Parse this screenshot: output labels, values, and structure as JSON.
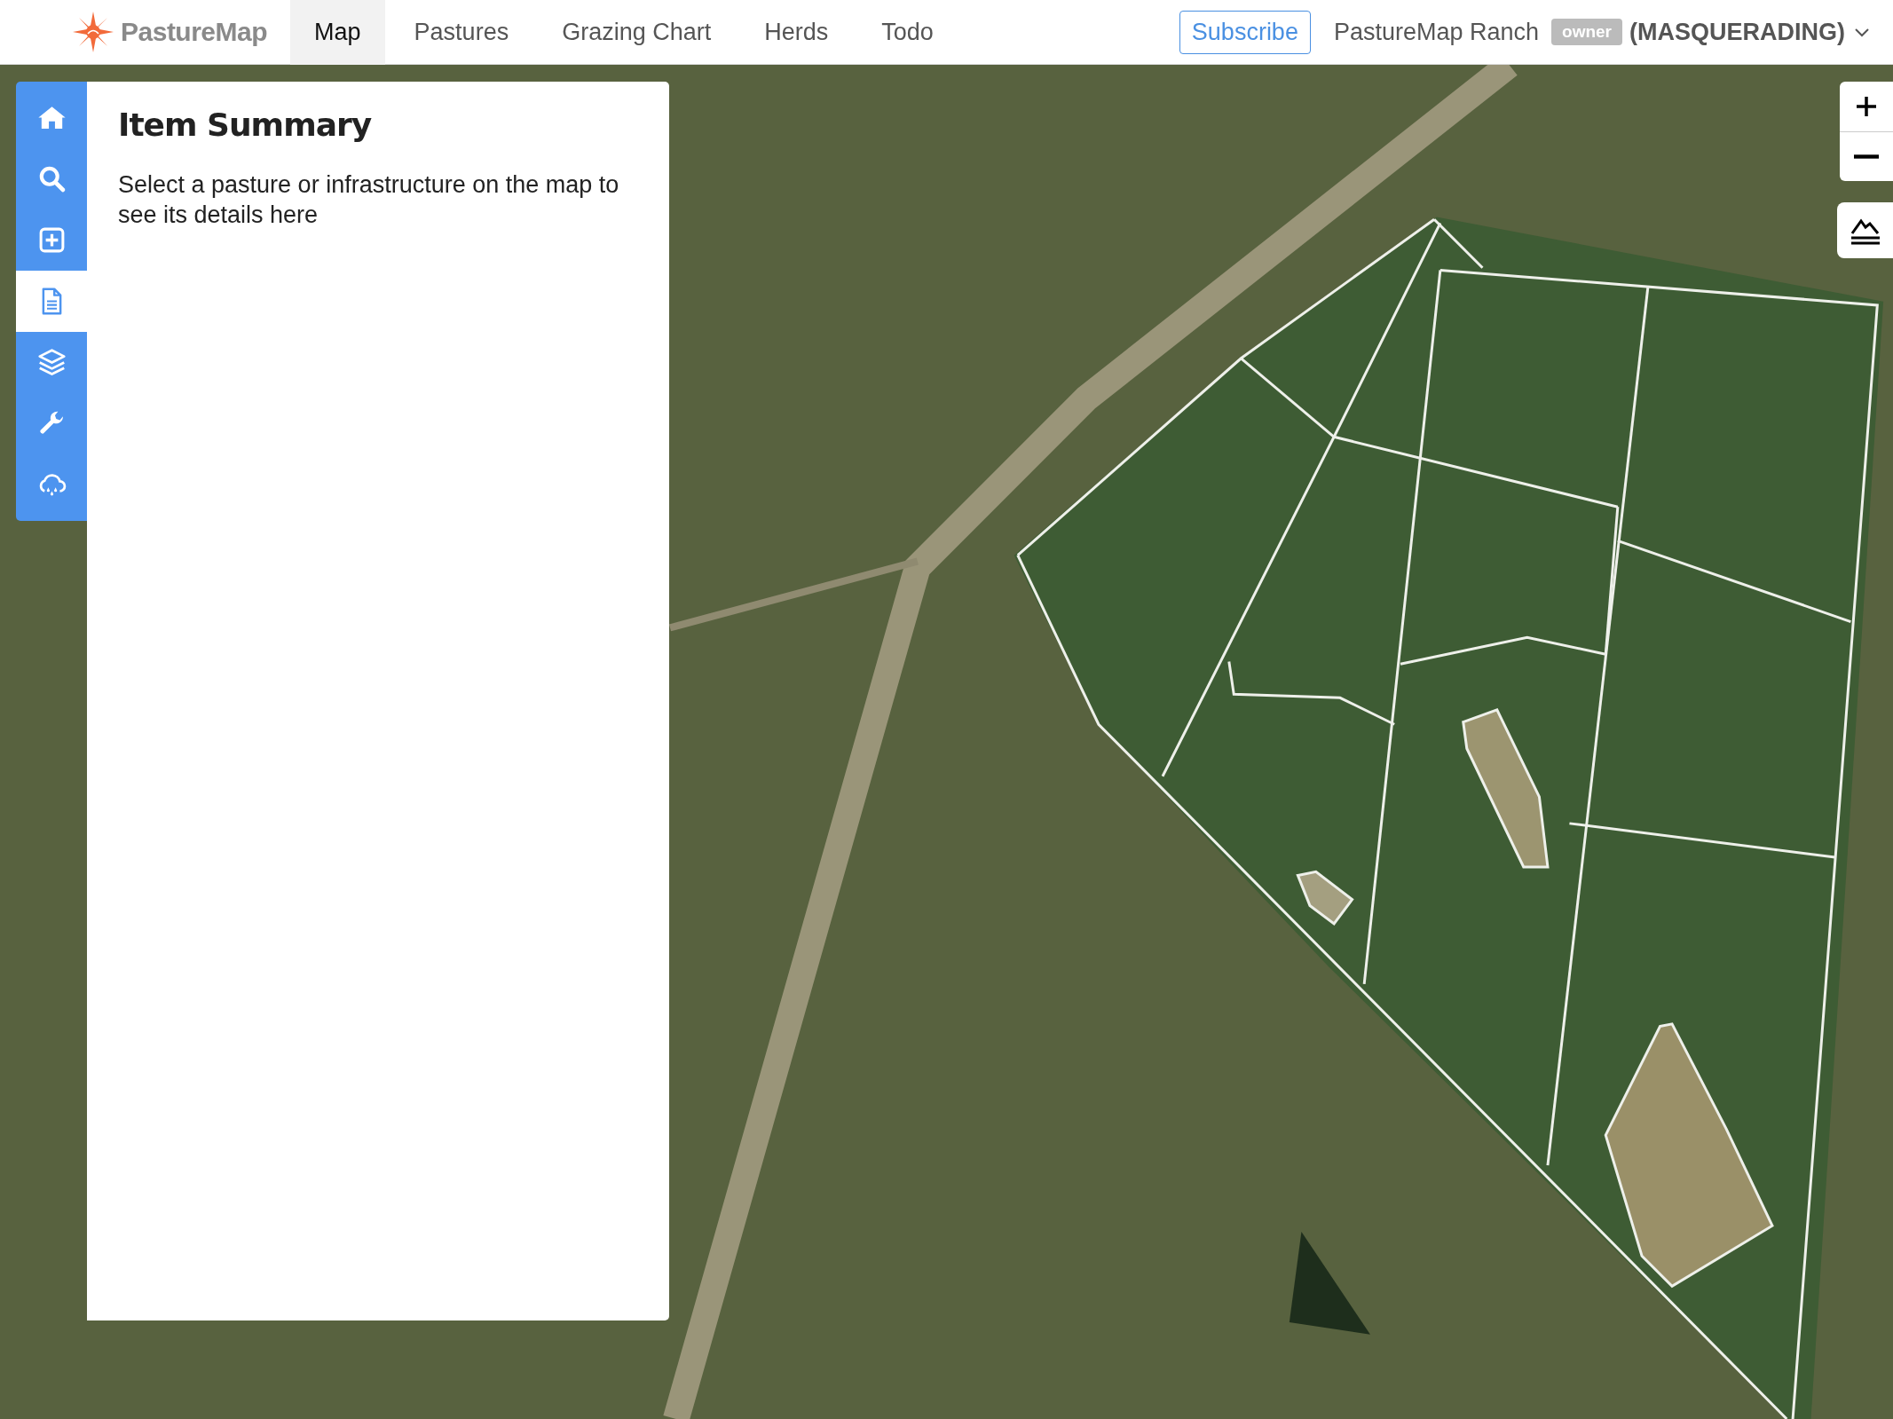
{
  "header": {
    "logo": "PastureMap",
    "tabs": [
      {
        "label": "Map",
        "selected": true
      },
      {
        "label": "Pastures",
        "selected": false
      },
      {
        "label": "Grazing Chart",
        "selected": false
      },
      {
        "label": "Herds",
        "selected": false
      },
      {
        "label": "Todo",
        "selected": false
      }
    ],
    "subscribe": "Subscribe",
    "ranch": "PastureMap Ranch",
    "role_badge": "owner",
    "mode": "(MASQUERADING)"
  },
  "rail": [
    {
      "kind": "home",
      "selected": false
    },
    {
      "kind": "search",
      "selected": false
    },
    {
      "kind": "add",
      "selected": false
    },
    {
      "kind": "document",
      "selected": true
    },
    {
      "kind": "layers",
      "selected": false
    },
    {
      "kind": "wrench",
      "selected": false
    },
    {
      "kind": "cloud",
      "selected": false
    }
  ],
  "panel": {
    "title": "Item Summary",
    "message": "Select a pasture or infrastructure on the map to see its details here"
  }
}
